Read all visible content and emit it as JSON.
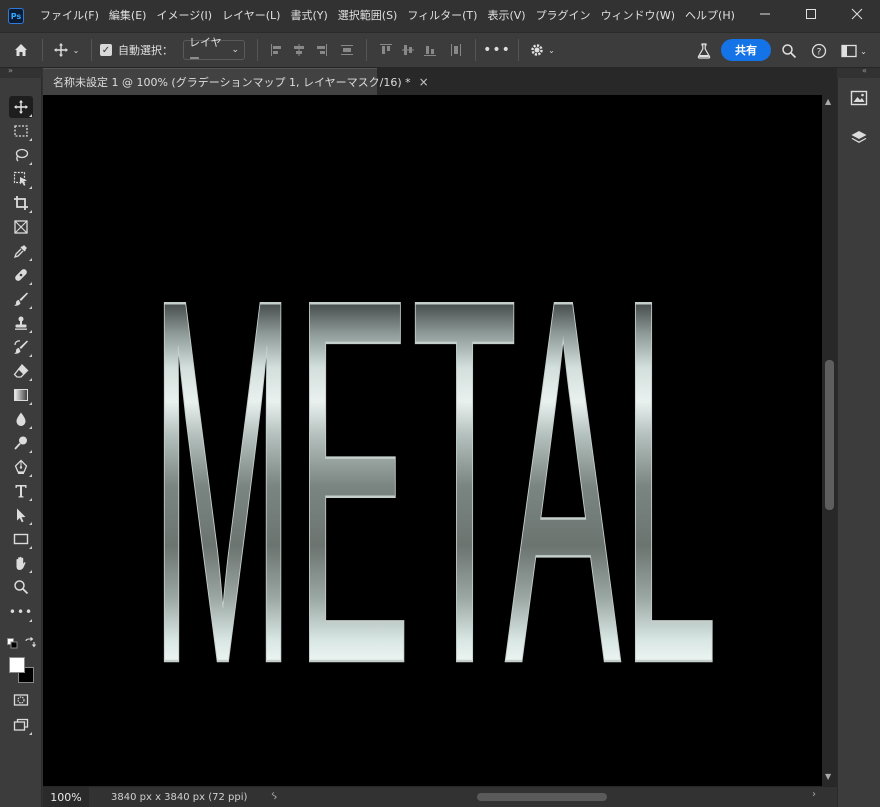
{
  "app": {
    "logo": "Ps",
    "menu": [
      "ファイル(F)",
      "編集(E)",
      "イメージ(I)",
      "レイヤー(L)",
      "書式(Y)",
      "選択範囲(S)",
      "フィルター(T)",
      "表示(V)",
      "プラグイン",
      "ウィンドウ(W)",
      "ヘルプ(H)"
    ],
    "window_controls": [
      "minimize-icon",
      "maximize-icon",
      "close-icon"
    ]
  },
  "options": {
    "auto_select_label": "自動選択：",
    "auto_select_checked": true,
    "layer_select_value": "レイヤー",
    "share_label": "共有"
  },
  "document": {
    "tab_title": "名称未設定 1 @ 100% (グラデーションマップ 1, レイヤーマスク/16) *",
    "canvas_text": "METAL"
  },
  "status": {
    "zoom": "100%",
    "doc_size": "3840 px x 3840 px (72 ppi)"
  },
  "colors": {
    "share_blue": "#1473e6",
    "foreground": "#ffffff",
    "background": "#000000"
  },
  "tools": [
    "move-icon",
    "marquee-icon",
    "lasso-icon",
    "object-select-icon",
    "crop-icon",
    "frame-icon",
    "eyedropper-icon",
    "healing-icon",
    "brush-icon",
    "stamp-icon",
    "history-brush-icon",
    "eraser-icon",
    "gradient-icon",
    "blur-icon",
    "dodge-icon",
    "pen-icon",
    "type-icon",
    "path-select-icon",
    "rectangle-icon",
    "hand-icon",
    "zoom-icon",
    "more-icon"
  ]
}
